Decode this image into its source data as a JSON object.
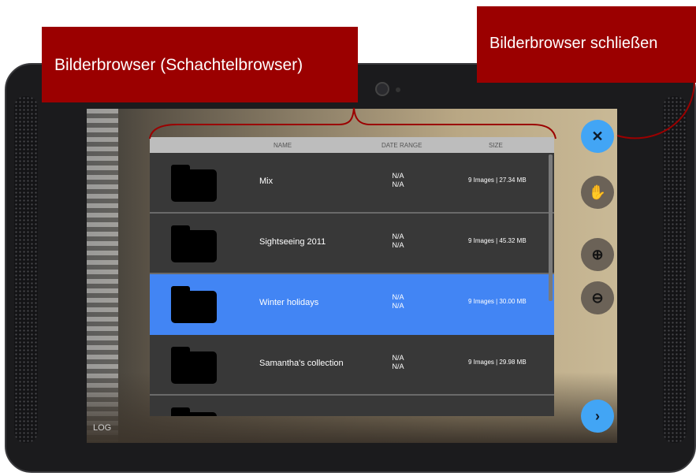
{
  "callouts": {
    "image_browser": "Bilderbrowser (Schachtelbrowser)",
    "close_browser": "Bilderbrowser schließen"
  },
  "screen": {
    "log_label": "LOG"
  },
  "browser": {
    "columns": [
      "NAME",
      "DATE RANGE",
      "SIZE"
    ],
    "rows": [
      {
        "name": "Mix",
        "date_from": "N/A",
        "date_to": "N/A",
        "size": "9 Images | 27.34 MB",
        "selected": false
      },
      {
        "name": "Sightseeing 2011",
        "date_from": "N/A",
        "date_to": "N/A",
        "size": "9 Images | 45.32 MB",
        "selected": false
      },
      {
        "name": "Winter holidays",
        "date_from": "N/A",
        "date_to": "N/A",
        "size": "9 Images | 30.00 MB",
        "selected": true
      },
      {
        "name": "Samantha's collection",
        "date_from": "N/A",
        "date_to": "N/A",
        "size": "9 Images | 29.98 MB",
        "selected": false
      }
    ]
  },
  "buttons": {
    "close": "✕",
    "pan": "✋",
    "zoom_in": "⊕",
    "zoom_out": "⊖",
    "next": "›"
  },
  "colors": {
    "callout": "#9b0000",
    "selected_row": "#4285f4",
    "fab_blue": "#42a5f5",
    "fab_grey": "#6b6257"
  },
  "icons": [
    "folder-icon",
    "close-icon",
    "hand-icon",
    "zoom-in-icon",
    "zoom-out-icon",
    "chevron-right-icon"
  ]
}
